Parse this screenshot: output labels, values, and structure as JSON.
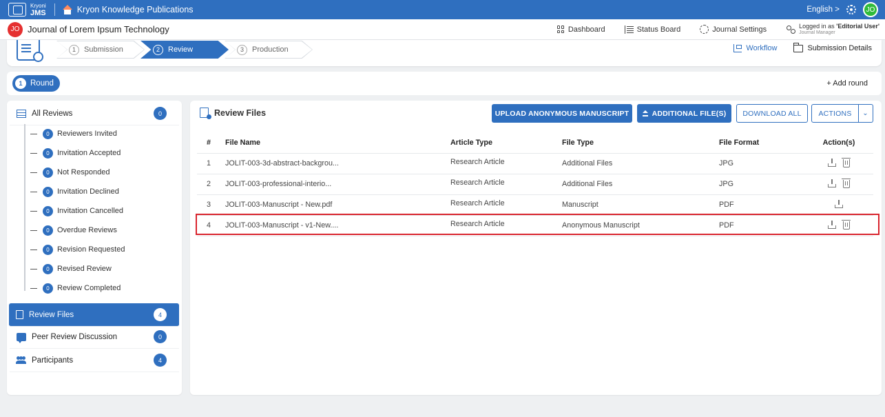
{
  "app": {
    "brand_small": "Kryoni",
    "brand_big": "JMS",
    "org_title": "Kryon Knowledge Publications",
    "language": "English",
    "user_initials": "JO"
  },
  "journal": {
    "initials": "JO",
    "title": "Journal of Lorem Ipsum Technology"
  },
  "subnav": {
    "dashboard": "Dashboard",
    "status_board": "Status Board",
    "journal_settings": "Journal Settings",
    "logged_prefix": "Logged in as ",
    "logged_user": "'Editorial User'",
    "logged_role": "Journal Manager"
  },
  "workflow": {
    "steps": [
      {
        "num": "1",
        "label": "Submission"
      },
      {
        "num": "2",
        "label": "Review"
      },
      {
        "num": "3",
        "label": "Production"
      }
    ],
    "workflow_link": "Workflow",
    "submission_details": "Submission Details"
  },
  "round": {
    "num": "1",
    "label": "Round",
    "add_round": "+ Add round"
  },
  "sidebar": {
    "all_reviews": {
      "label": "All Reviews",
      "count": "0"
    },
    "sub_items": [
      {
        "label": "Reviewers Invited",
        "count": "0"
      },
      {
        "label": "Invitation Accepted",
        "count": "0"
      },
      {
        "label": "Not Responded",
        "count": "0"
      },
      {
        "label": "Invitation Declined",
        "count": "0"
      },
      {
        "label": "Invitation Cancelled",
        "count": "0"
      },
      {
        "label": "Overdue Reviews",
        "count": "0"
      },
      {
        "label": "Revision Requested",
        "count": "0"
      },
      {
        "label": "Revised Review",
        "count": "0"
      },
      {
        "label": "Review Completed",
        "count": "0"
      }
    ],
    "review_files": {
      "label": "Review Files",
      "count": "4"
    },
    "peer_review": {
      "label": "Peer Review Discussion",
      "count": "0"
    },
    "participants": {
      "label": "Participants",
      "count": "4"
    }
  },
  "main": {
    "title": "Review Files",
    "buttons": {
      "upload": "UPLOAD ANONYMOUS MANUSCRIPT",
      "additional": "ADDITIONAL FILE(S)",
      "download_all": "DOWNLOAD ALL",
      "actions": "ACTIONS"
    },
    "columns": [
      "#",
      "File Name",
      "Article Type",
      "File Type",
      "File Format",
      "Action(s)"
    ],
    "rows": [
      {
        "num": "1",
        "file_name": "JOLIT-003-3d-abstract-backgrou...",
        "article_type": "Research Article",
        "file_type": "Additional Files",
        "format": "JPG",
        "deletable": true
      },
      {
        "num": "2",
        "file_name": "JOLIT-003-professional-interio...",
        "article_type": "Research Article",
        "file_type": "Additional Files",
        "format": "JPG",
        "deletable": true
      },
      {
        "num": "3",
        "file_name": "JOLIT-003-Manuscript - New.pdf",
        "article_type": "Research Article",
        "file_type": "Manuscript",
        "format": "PDF",
        "deletable": false
      },
      {
        "num": "4",
        "file_name": "JOLIT-003-Manuscript - v1-New....",
        "article_type": "Research Article",
        "file_type": "Anonymous Manuscript",
        "format": "PDF",
        "deletable": true
      }
    ]
  },
  "colors": {
    "primary": "#2f6fbf",
    "highlight": "#d9232c",
    "avatar_red": "#e53030",
    "avatar_green": "#2fbb3a"
  }
}
